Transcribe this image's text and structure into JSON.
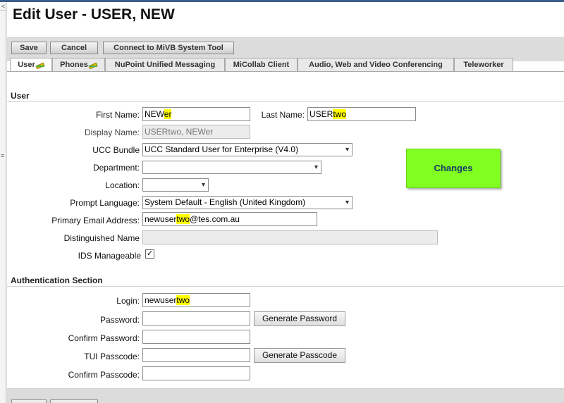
{
  "page": {
    "title": "Edit User - USER, NEW"
  },
  "toolbar": {
    "save_label": "Save",
    "cancel_label": "Cancel",
    "connect_label": "Connect to MiVB System Tool"
  },
  "tabs": [
    {
      "label": "User",
      "edited": true,
      "active": true
    },
    {
      "label": "Phones",
      "edited": true,
      "active": false
    },
    {
      "label": "NuPoint Unified Messaging",
      "active": false
    },
    {
      "label": "MiCollab Client",
      "active": false
    },
    {
      "label": "Audio, Web and Video Conferencing",
      "active": false
    },
    {
      "label": "Teleworker",
      "active": false
    }
  ],
  "user_section": {
    "heading": "User",
    "first_name": {
      "label": "First Name:",
      "value_plain": "NEW",
      "value_highlight": "er"
    },
    "last_name": {
      "label": "Last Name:",
      "value_plain": "USER",
      "value_highlight": "two"
    },
    "display_name": {
      "label": "Display Name:",
      "value": "USERtwo, NEWer"
    },
    "ucc_bundle": {
      "label": "UCC Bundle",
      "value": "UCC Standard User for Enterprise (V4.0)"
    },
    "department": {
      "label": "Department:",
      "value": ""
    },
    "location": {
      "label": "Location:",
      "value": ""
    },
    "prompt_language": {
      "label": "Prompt Language:",
      "value": "System Default - English (United Kingdom)"
    },
    "primary_email": {
      "label": "Primary Email Address:",
      "value_before": "newuser",
      "value_highlight": "two",
      "value_after": "@tes.com.au"
    },
    "distinguished_name": {
      "label": "Distinguished Name",
      "value": ""
    },
    "ids_manageable": {
      "label": "IDS Manageable",
      "checked": true,
      "check_glyph": "✓"
    }
  },
  "auth_section": {
    "heading": "Authentication Section",
    "login": {
      "label": "Login:",
      "value_plain": "newuser",
      "value_highlight": "two"
    },
    "password": {
      "label": "Password:",
      "value": ""
    },
    "confirm_password": {
      "label": "Confirm Password:",
      "value": ""
    },
    "tui_passcode": {
      "label": "TUI Passcode:",
      "value": ""
    },
    "confirm_passcode": {
      "label": "Confirm Passcode:",
      "value": ""
    },
    "generate_password_label": "Generate Password",
    "generate_passcode_label": "Generate Passcode"
  },
  "annotation": {
    "text": "Changes",
    "color": "#80ff20"
  },
  "icons": {
    "dropdown": "▾",
    "gutter_corner": "<",
    "gutter_grip": "≡"
  },
  "colors": {
    "highlight": "#ffff00",
    "title_bar": "#3a5f8c"
  }
}
